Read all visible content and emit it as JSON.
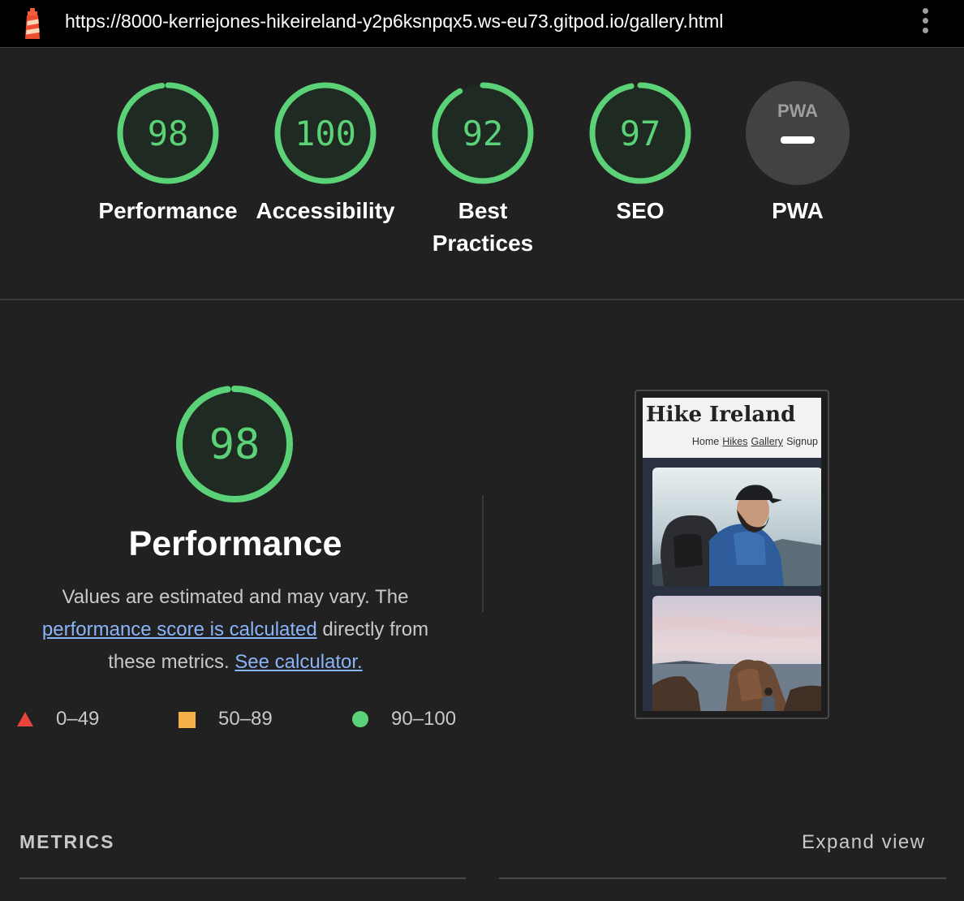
{
  "browser": {
    "url": "https://8000-kerriejones-hikeireland-y2p6ksnpqx5.ws-eu73.gitpod.io/gallery.html"
  },
  "colors": {
    "pass": "#5bd178",
    "average": "#f7b14b",
    "fail": "#e8453c",
    "link": "#8ab4f8",
    "background": "#212121"
  },
  "scores": [
    {
      "label": "Performance",
      "value": "98",
      "fraction": 0.98
    },
    {
      "label": "Accessibility",
      "value": "100",
      "fraction": 1.0
    },
    {
      "label": "Best Practices",
      "value": "92",
      "fraction": 0.92
    },
    {
      "label": "SEO",
      "value": "97",
      "fraction": 0.97
    },
    {
      "label": "PWA",
      "value": "PWA",
      "icon": "pwa-dash-icon"
    }
  ],
  "performance": {
    "score": "98",
    "fraction": 0.98,
    "title": "Performance",
    "desc_prefix": "Values are estimated and may vary. The ",
    "desc_link": "performance score is calculated",
    "desc_mid": " directly from these metrics. ",
    "calc_link": "See calculator."
  },
  "legend": [
    {
      "range": "0–49",
      "icon": "triangle-icon"
    },
    {
      "range": "50–89",
      "icon": "square-icon"
    },
    {
      "range": "90–100",
      "icon": "circle-icon"
    }
  ],
  "screenshot": {
    "site_title": "Hike Ireland",
    "nav": [
      "Home",
      "Hikes",
      "Gallery",
      "Signup"
    ]
  },
  "metrics": {
    "title": "METRICS",
    "expand": "Expand view"
  }
}
